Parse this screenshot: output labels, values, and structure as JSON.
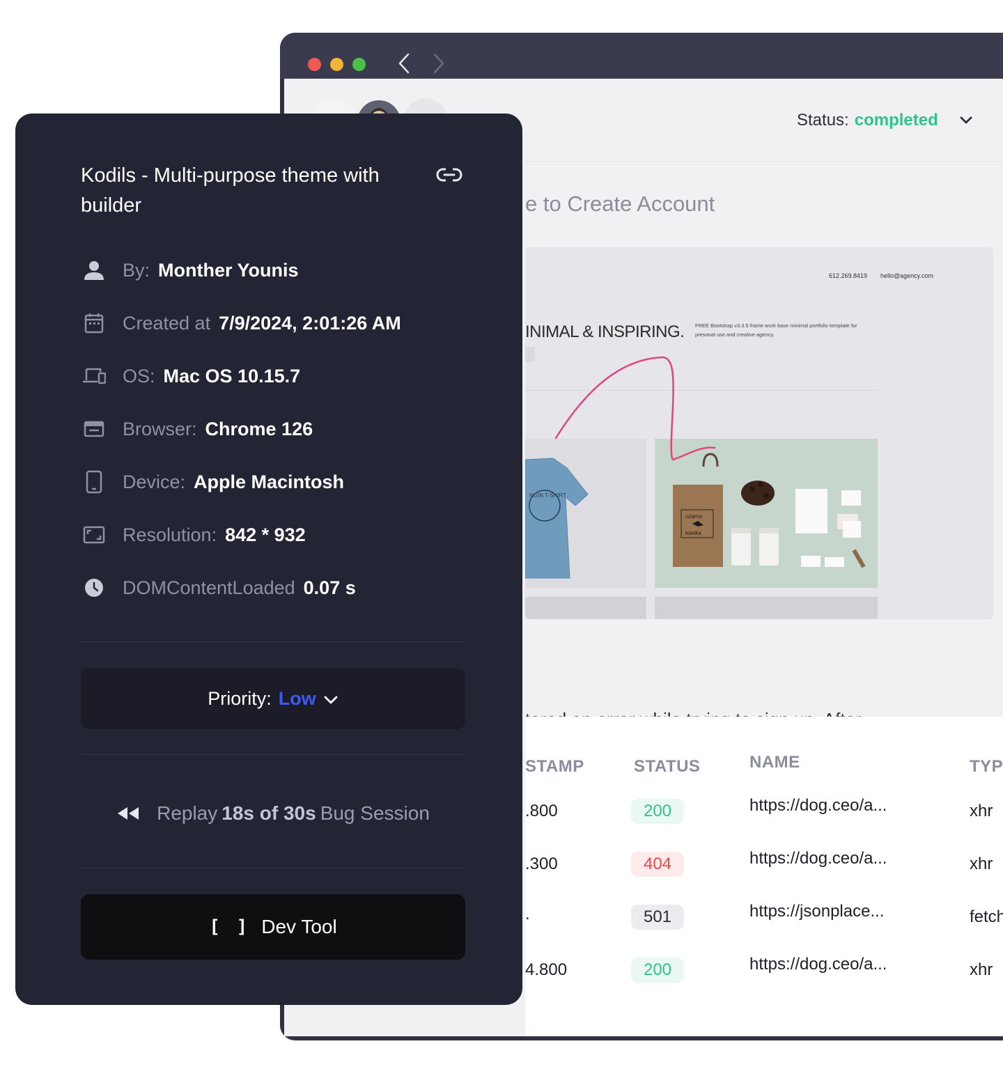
{
  "browser": {
    "status_label": "Status:",
    "status_value": "completed",
    "bug_title": "e to Create Account",
    "bug_description": "tered an error while trying to sign up. After",
    "screenshot": {
      "phone": "612.269.8419",
      "email": "hello@agency.com",
      "headline": "INIMAL & INSPIRING.",
      "description": "FREE Bootstrap v3.3.5 frame work base minimal portfolio template for presonal use and creative agency.",
      "bag_brand_1": "czarna",
      "bag_brand_2": "kawka",
      "tshirt_text": "NGIN T-SHIRT",
      "scribble_color": "#e0457b"
    },
    "network": {
      "columns": [
        "STAMP",
        "STATUS",
        "NAME",
        "TYPE"
      ],
      "rows": [
        {
          "stamp": ".800",
          "status": "200",
          "name": "https://dog.ceo/a...",
          "type": "xhr"
        },
        {
          "stamp": ".300",
          "status": "404",
          "name": "https://dog.ceo/a...",
          "type": "xhr"
        },
        {
          "stamp": ".",
          "status": "501",
          "name": "https://jsonplace...",
          "type": "fetch"
        },
        {
          "stamp": "4.800",
          "status": "200",
          "name": "https://dog.ceo/a...",
          "type": "xhr"
        }
      ]
    }
  },
  "panel": {
    "title": "Kodils - Multi-purpose theme with builder",
    "meta": {
      "by_label": "By:",
      "by_value": "Monther Younis",
      "created_label": "Created at",
      "created_value": "7/9/2024, 2:01:26 AM",
      "os_label": "OS:",
      "os_value": "Mac OS 10.15.7",
      "browser_label": "Browser:",
      "browser_value": "Chrome 126",
      "device_label": "Device:",
      "device_value": "Apple Macintosh",
      "resolution_label": "Resolution:",
      "resolution_value": "842 * 932",
      "dcl_label": "DOMContentLoaded",
      "dcl_value": "0.07 s"
    },
    "priority_label": "Priority:",
    "priority_value": "Low",
    "replay_prefix": "Replay",
    "replay_strong": "18s of 30s",
    "replay_suffix": "Bug Session",
    "devtool_glyph": "[ ]",
    "devtool_label": "Dev Tool"
  },
  "colors": {
    "panel_bg": "#232534",
    "status_green": "#2fc489",
    "priority_blue": "#3b5bf0",
    "error_red": "#ec4a4a"
  }
}
